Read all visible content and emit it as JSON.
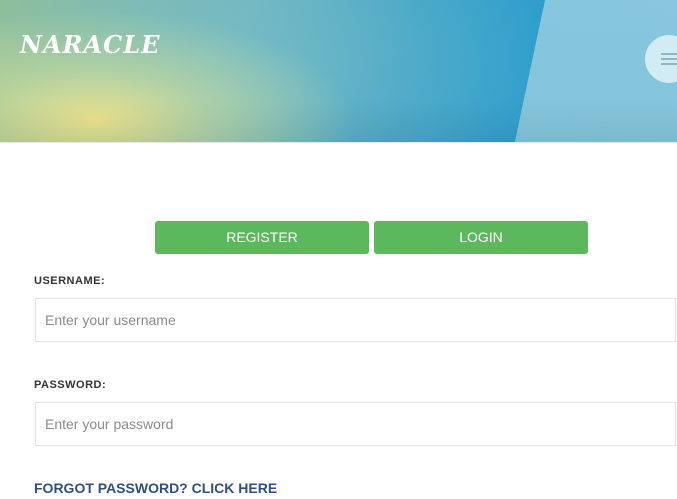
{
  "header": {
    "logo_text": "NARACLE",
    "menu_icon": "hamburger-icon"
  },
  "tabs": {
    "register_label": "REGISTER",
    "login_label": "LOGIN",
    "active_color": "#5cb85c"
  },
  "form": {
    "username_label": "USERNAME:",
    "username_placeholder": "Enter your username",
    "password_label": "PASSWORD:",
    "password_placeholder": "Enter your password",
    "forgot_text": "FORGOT PASSWORD? CLICK HERE",
    "link_color": "#2f4f7f"
  }
}
